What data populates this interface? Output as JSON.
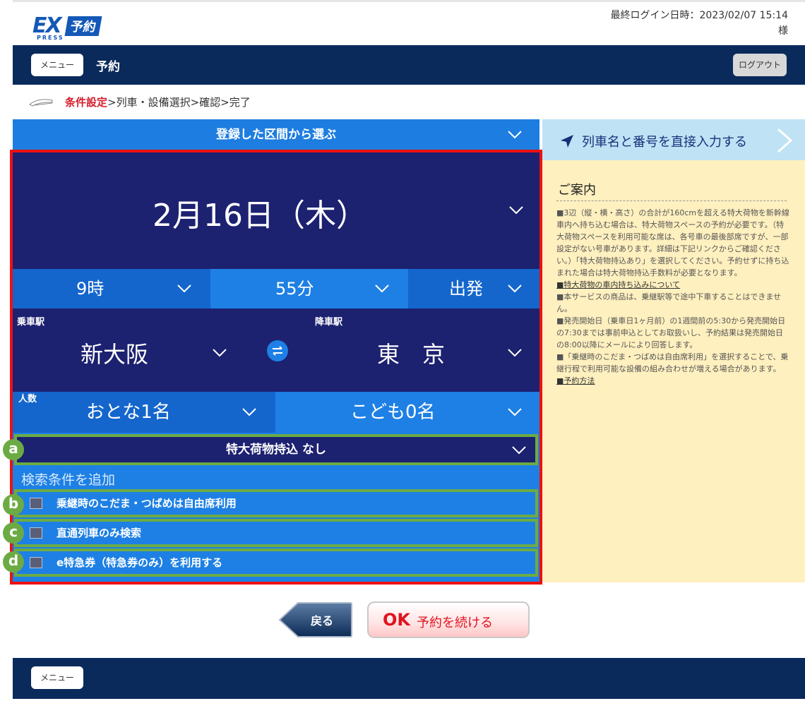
{
  "header": {
    "logo_ex": "EX",
    "logo_yoyaku": "予約",
    "logo_press": "PRESS",
    "last_login": "最終ログイン日時：2023/02/07 15:14",
    "user_suffix": "様"
  },
  "nav": {
    "menu_label": "メニュー",
    "title": "予約",
    "logout_label": "ログアウト"
  },
  "breadcrumb": {
    "active": "条件設定",
    "rest": ">列車・設備選択>確認>完了"
  },
  "form": {
    "route_select_label": "登録した区間から選ぶ",
    "date": "2月16日（木）",
    "hour": "9時",
    "minute": "55分",
    "time_type": "出発",
    "from_label": "乗車駅",
    "from_station": "新大阪",
    "to_label": "降車駅",
    "to_station": "東　京",
    "people_label": "人数",
    "adults": "おとな1名",
    "children": "こども0名",
    "baggage": "特大荷物持込 なし",
    "add_conditions": "検索条件を追加",
    "options": [
      {
        "badge": "b",
        "label": "乗継時のこだま・つばめは自由席利用"
      },
      {
        "badge": "c",
        "label": "直通列車のみ検索"
      },
      {
        "badge": "d",
        "label": "e特急券（特急券のみ）を利用する"
      }
    ],
    "baggage_badge": "a"
  },
  "right": {
    "direct_input": "列車名と番号を直接入力する",
    "notice_title": "ご案内",
    "notice_paragraphs": [
      "■3辺（縦・横・高さ）の合計が160cmを超える特大荷物を新幹線車内へ持ち込む場合は、特大荷物スペースの予約が必要です。（特大荷物スペースを利用可能な席は、各号車の最後部席ですが、一部設定がない号車があります。詳細は下記リンクからご確認ください。）「特大荷物持込あり」を選択してください。予約せずに持ち込まれた場合は特大荷物持込手数料が必要となります。",
      "■特大荷物の車内持ち込みについて",
      "■本サービスの商品は、乗継駅等で途中下車することはできません。",
      "■発売開始日（乗車日1ヶ月前）の1週間前の5:30から発売開始日の7:30までは事前申込としてお取扱いし、予約結果は発売開始日の8:00以降にメールにより回答します。",
      "■「乗継時のこだま・つばめは自由席利用」を選択することで、乗継行程で利用可能な設備の組み合わせが増える場合があります。",
      "■予約方法"
    ]
  },
  "buttons": {
    "back": "戻る",
    "ok_mark": "OK",
    "ok_label": "予約を続ける"
  },
  "footer": {
    "menu_label": "メニュー"
  }
}
